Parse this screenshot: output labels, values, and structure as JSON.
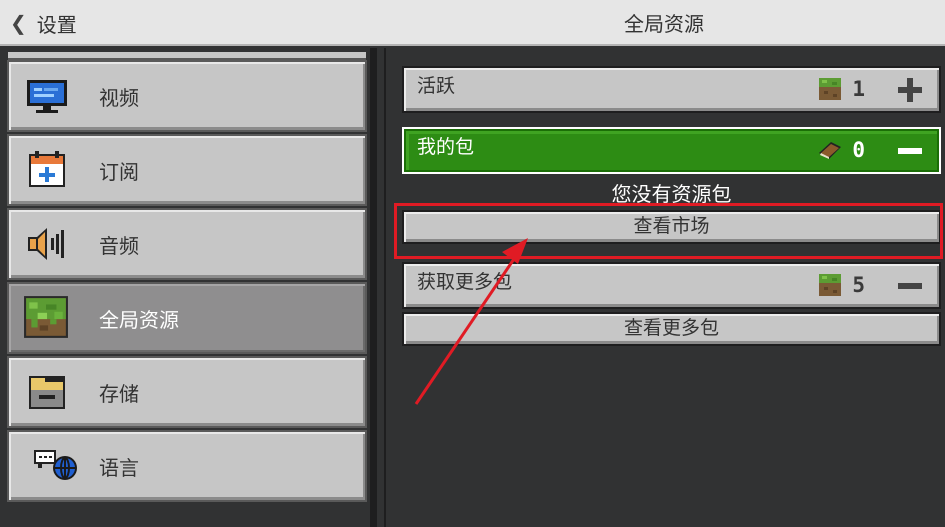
{
  "header": {
    "back_label": "设置",
    "title": "全局资源"
  },
  "sidebar": {
    "items": [
      {
        "label": "视频",
        "icon": "monitor-icon"
      },
      {
        "label": "订阅",
        "icon": "calendar-add-icon"
      },
      {
        "label": "音频",
        "icon": "speaker-icon"
      },
      {
        "label": "全局资源",
        "icon": "grass-block-icon",
        "active": true
      },
      {
        "label": "存储",
        "icon": "storage-folder-icon"
      },
      {
        "label": "语言",
        "icon": "chat-globe-icon"
      }
    ]
  },
  "main": {
    "active_section": {
      "label": "活跃",
      "count": "1",
      "action": "plus-icon"
    },
    "my_packs": {
      "label": "我的包",
      "count": "0",
      "action": "minus-icon"
    },
    "empty_message": "您没有资源包",
    "view_market_label": "查看市场",
    "get_more": {
      "label": "获取更多包",
      "count": "5",
      "action": "minus-icon"
    },
    "view_more_label": "查看更多包"
  },
  "colors": {
    "accent_green": "#2d8c14",
    "highlight_red": "#e01b24",
    "panel_gray": "#c6c6c6",
    "background": "#313233"
  }
}
